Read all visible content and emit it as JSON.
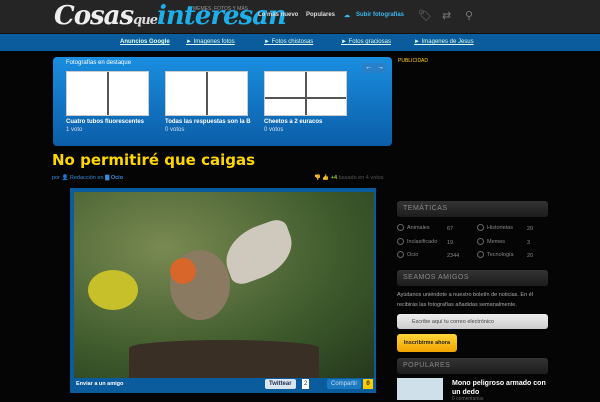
{
  "header": {
    "logo_main": "Cosas",
    "logo_que": "que",
    "logo_accent": "interesan",
    "tagline": "MEMES, FOTOS Y MÁS",
    "nav": [
      "Lo más nuevo",
      "Populares",
      "Subir fotografías"
    ]
  },
  "subnav": [
    "Anuncios Google",
    "► Imagenes fotos",
    "► Fotos chistosas",
    "► Fotos graciosas",
    "► Imagenes de Jesus"
  ],
  "featured": {
    "title": "Fotografías en destaque",
    "prev": "←",
    "next": "→",
    "items": [
      {
        "title": "Cuatro tubos fluorescentes",
        "votes": "1 voto"
      },
      {
        "title": "Todas las respuestas son la B",
        "votes": "0 votos"
      },
      {
        "title": "Cheetos a 2 euracos",
        "votes": "0 votos"
      }
    ]
  },
  "ad_label": "PUBLICIDAD",
  "post": {
    "title": "No permitiré que caigas",
    "by": "por",
    "author": "Redacción",
    "in": "en",
    "category": "Ocio",
    "score": "+4",
    "based": "basado en 4 votos",
    "send": "Enviar a un amigo",
    "tweet": "Twittear",
    "tweet_count": "2",
    "share": "Compartir",
    "share_count": "0"
  },
  "sidebar": {
    "tematicas": "TEMÁTICAS",
    "cats": [
      {
        "name": "Animales",
        "n": "67"
      },
      {
        "name": "Historietas",
        "n": "20"
      },
      {
        "name": "Inclasificado",
        "n": "19"
      },
      {
        "name": "Memes",
        "n": "3"
      },
      {
        "name": "Ocio",
        "n": "2344"
      },
      {
        "name": "Tecnología",
        "n": "20"
      }
    ],
    "amigos": "SEAMOS AMIGOS",
    "amigos_text": "Ayúdanos uniéndote a nuestro boletín de noticias. En él recibirás las fotografías añadidas semanalmente.",
    "email_placeholder": "Escribe aquí tu correo electrónico",
    "subscribe": "Inscribirme ahora",
    "populares": "POPULARES",
    "popular_title": "Mono peligroso armado con un dedo",
    "popular_comments": "0 comentarios"
  }
}
